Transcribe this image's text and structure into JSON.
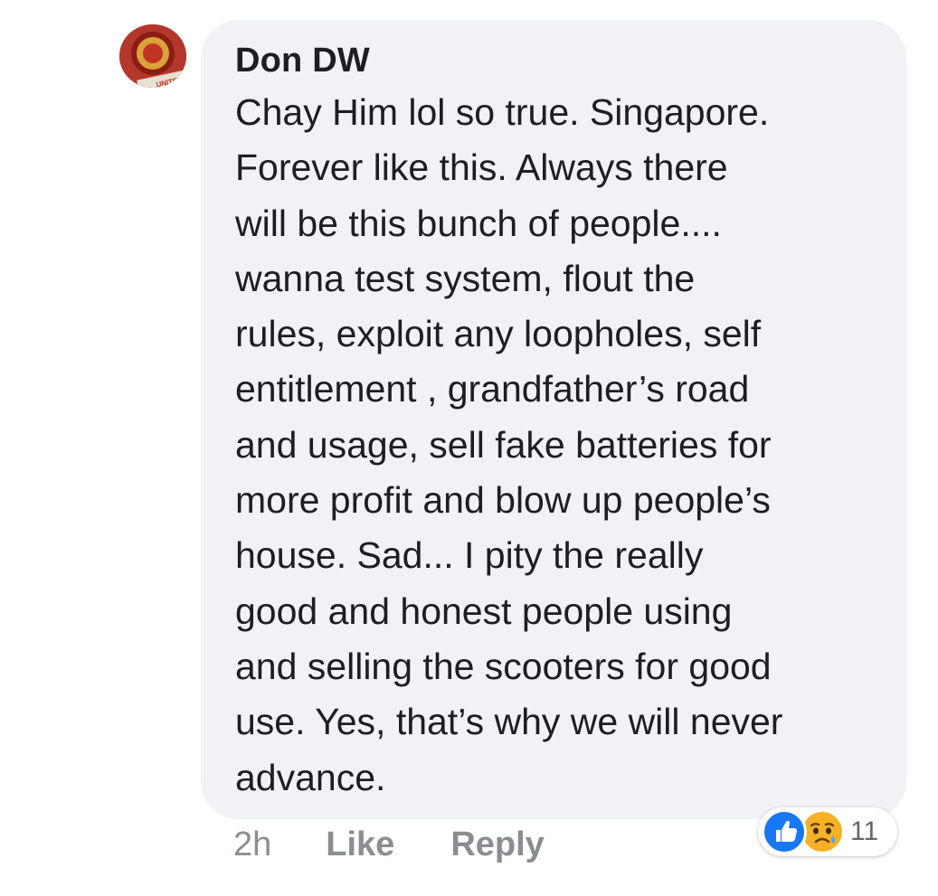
{
  "comment": {
    "author": "Don DW",
    "lines": [
      "Chay Him lol so true. Singapore.",
      "Forever like this. Always there",
      "will be this bunch of people....",
      "wanna test system, flout the",
      "rules, exploit any loopholes, self",
      "entitlement , grandfather’s road",
      "and usage, sell fake batteries for",
      "more profit and blow up people’s",
      "house. Sad... I pity the really",
      "good and honest people using",
      "and selling the scooters for good",
      "use. Yes, that’s why we will never",
      "advance."
    ]
  },
  "actions": {
    "time": "2h",
    "like_label": "Like",
    "reply_label": "Reply"
  },
  "reactions": {
    "icons": [
      "like-icon",
      "sad-icon"
    ],
    "count": "11"
  },
  "avatar": {
    "text": "UNITED"
  },
  "colors": {
    "bubble": "#f0f2f5",
    "text": "#1c1e21",
    "muted": "#8a8d91",
    "like_blue": "#1877f2",
    "sad_yellow": "#f7b125"
  }
}
